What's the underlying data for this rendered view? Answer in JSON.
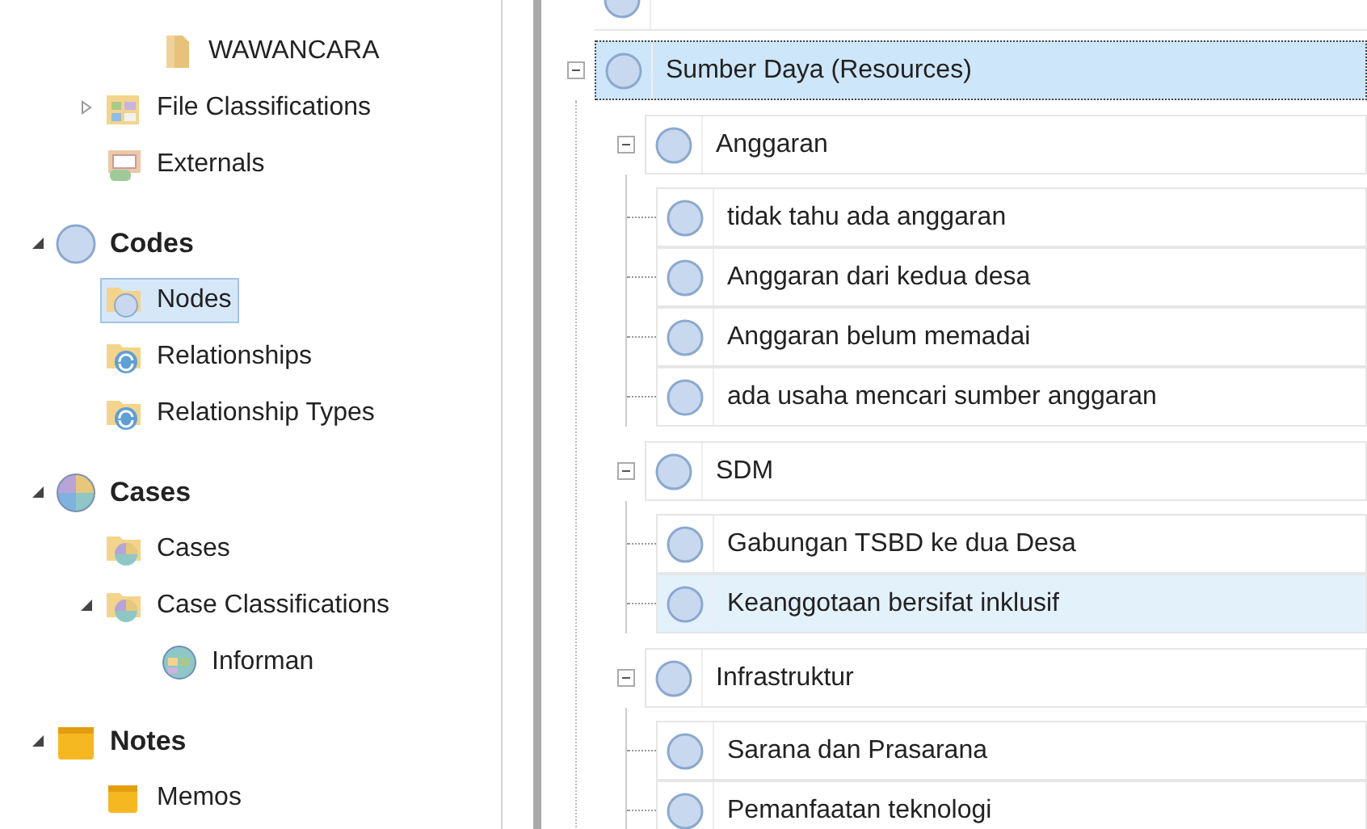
{
  "sidebar": {
    "sections": [
      {
        "items": [
          {
            "children": [
              {
                "label": "WAWANCARA",
                "kind": "folder"
              }
            ]
          },
          {
            "label": "File Classifications",
            "kind": "classification",
            "expanded": false,
            "selected": false
          },
          {
            "label": "Externals",
            "kind": "externals",
            "selected": false
          }
        ]
      },
      {
        "heading": "Codes",
        "kind": "node",
        "expanded": true,
        "items": [
          {
            "label": "Nodes",
            "kind": "nodefolder",
            "selected": true
          },
          {
            "label": "Relationships",
            "kind": "relationship",
            "selected": false
          },
          {
            "label": "Relationship Types",
            "kind": "relationship",
            "selected": false
          }
        ]
      },
      {
        "heading": "Cases",
        "kind": "case",
        "expanded": true,
        "items": [
          {
            "label": "Cases",
            "kind": "casefolder",
            "selected": false
          },
          {
            "label": "Case Classifications",
            "kind": "casefolder",
            "expanded": true,
            "selected": false,
            "children": [
              {
                "label": "Informan",
                "kind": "caseclass"
              }
            ]
          }
        ]
      },
      {
        "heading": "Notes",
        "kind": "notes",
        "expanded": true,
        "items": [
          {
            "label": "Memos",
            "kind": "notes",
            "selected": false
          }
        ]
      }
    ]
  },
  "node_tree": {
    "nodes": [
      {
        "label": "Sumber Daya (Resources)",
        "selected": true,
        "expanded": true,
        "children": [
          {
            "label": "Anggaran",
            "expanded": true,
            "selected": false,
            "children": [
              {
                "label": "tidak tahu ada anggaran",
                "selected": false,
                "hovered": false
              },
              {
                "label": "Anggaran dari kedua desa",
                "selected": false,
                "hovered": false
              },
              {
                "label": "Anggaran belum memadai",
                "selected": false,
                "hovered": false
              },
              {
                "label": "ada usaha mencari sumber anggaran",
                "selected": false,
                "hovered": false
              }
            ]
          },
          {
            "label": "SDM",
            "expanded": true,
            "selected": false,
            "children": [
              {
                "label": "Gabungan TSBD ke dua Desa",
                "selected": false,
                "hovered": false
              },
              {
                "label": "Keanggotaan bersifat inklusif",
                "selected": false,
                "hovered": true
              }
            ]
          },
          {
            "label": "Infrastruktur",
            "expanded": true,
            "selected": false,
            "children": [
              {
                "label": "Sarana dan Prasarana",
                "selected": false,
                "hovered": false
              },
              {
                "label": "Pemanfaatan teknologi",
                "selected": false,
                "hovered": false
              }
            ]
          }
        ]
      }
    ]
  }
}
